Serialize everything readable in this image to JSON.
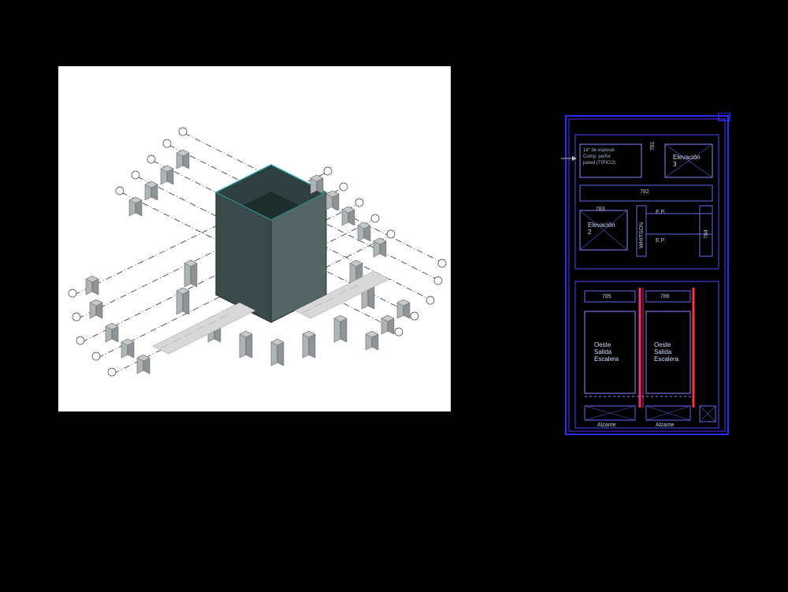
{
  "left_panel": {
    "description": "isometric-foundation-plan"
  },
  "right": {
    "note_line1": "18\" de espesor",
    "note_line2": "Comp. perfor",
    "note_line3": "pared (TIPICO)",
    "elev3": "Elevación\n3",
    "elev2": "Elevación\n2",
    "ep1": "E.P.",
    "ep2": "E.P.",
    "whitson": "WHITSON",
    "n781": "781",
    "n782": "782",
    "n783": "783",
    "n784": "784",
    "n785": "785",
    "n786": "786",
    "oeste1": "Oeste\nSalida\nEscalera",
    "oeste2": "Oeste\nSalida\nEscalera",
    "alzante1": "Alzante",
    "alzante2": "Alzante"
  }
}
